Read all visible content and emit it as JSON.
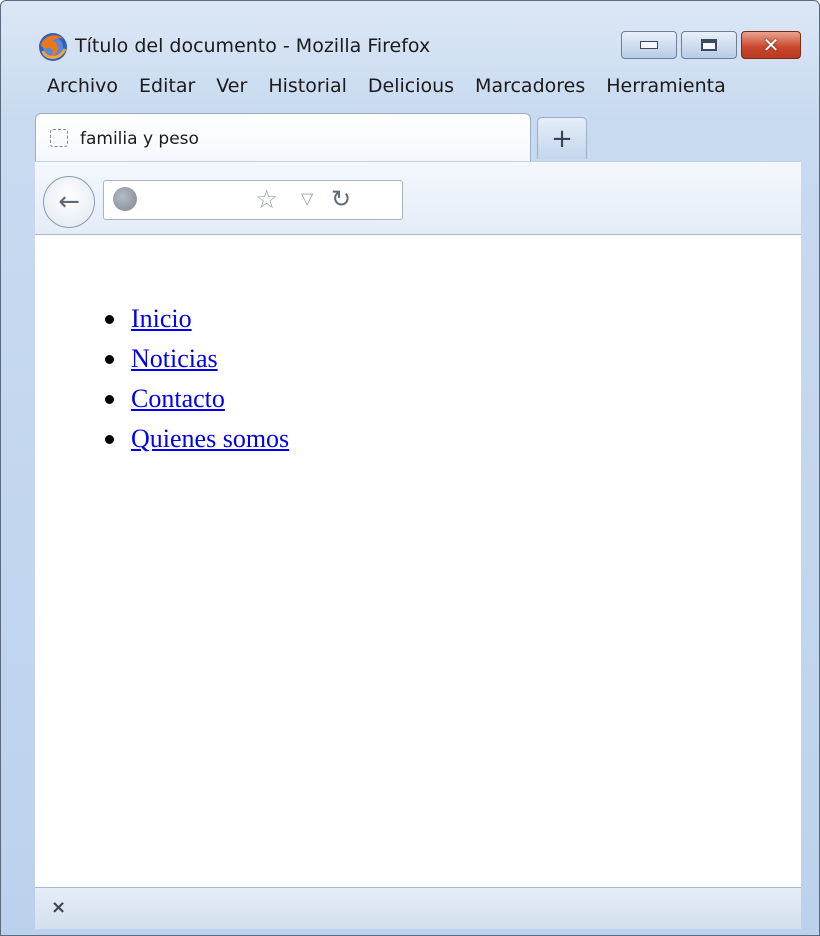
{
  "window": {
    "title": "Título del documento - Mozilla Firefox",
    "buttons": {
      "minimize": "minimize",
      "maximize": "maximize",
      "close": "✕"
    }
  },
  "menubar": {
    "items": [
      "Archivo",
      "Editar",
      "Ver",
      "Historial",
      "Delicious",
      "Marcadores",
      "Herramienta"
    ]
  },
  "tabs": {
    "active_label": "familia y peso",
    "new_tab_label": "+"
  },
  "navbar": {
    "back": "←",
    "star": "☆",
    "dropdown": "▽",
    "reload": "↻"
  },
  "content": {
    "links": [
      "Inicio",
      "Noticias",
      "Contacto",
      "Quienes somos"
    ]
  },
  "statusbar": {
    "close": "×"
  },
  "colors": {
    "link": "#0000ee",
    "chrome": "#c8daf0",
    "close_button": "#c9462c"
  }
}
